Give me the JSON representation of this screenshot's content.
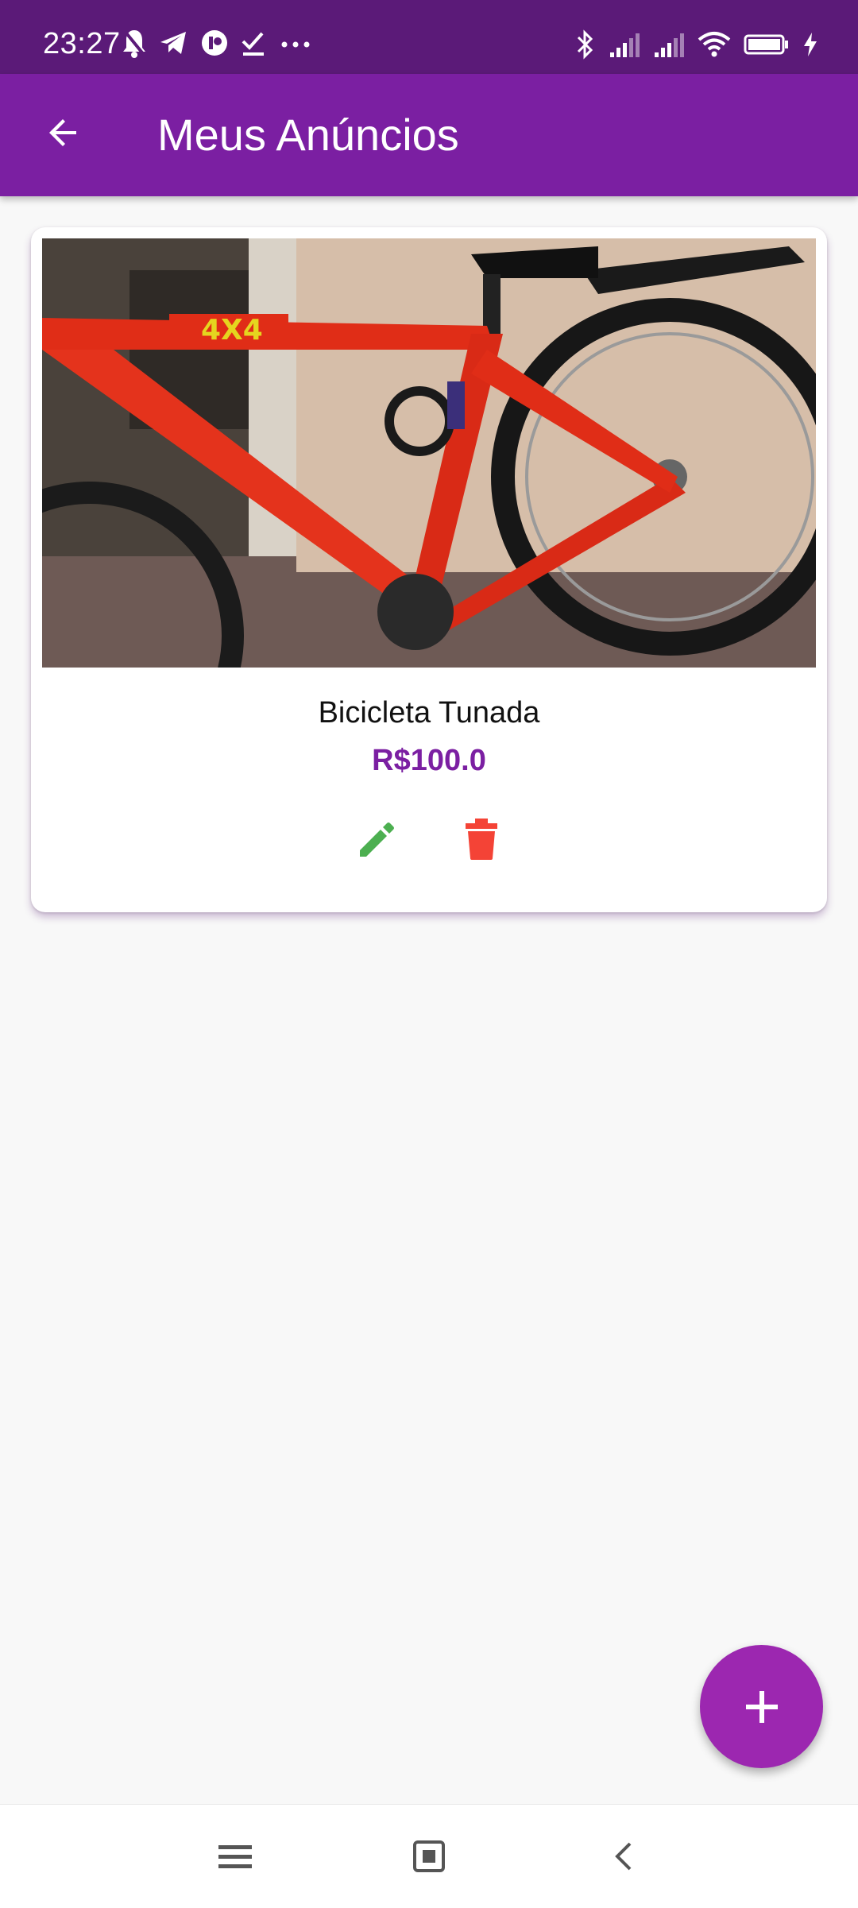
{
  "status_bar": {
    "time": "23:27",
    "icons_left": [
      "silent-bell-icon",
      "telegram-icon",
      "app-icon",
      "task-check-icon",
      "more-dots-icon"
    ],
    "icons_right": [
      "bluetooth-icon",
      "signal-icon",
      "signal-icon",
      "wifi-icon",
      "battery-icon",
      "charging-icon"
    ]
  },
  "app_bar": {
    "title": "Meus Anúncios",
    "back_icon": "arrow-back-icon"
  },
  "listing": {
    "title": "Bicicleta Tunada",
    "price": "R$100.0",
    "image_text": "4X4",
    "image_alt": "red mountain bike"
  },
  "actions": {
    "edit_icon": "pencil-icon",
    "delete_icon": "trash-icon"
  },
  "fab": {
    "icon": "plus-icon"
  },
  "nav": {
    "items": [
      "menu-icon",
      "home-square-icon",
      "back-chevron-icon"
    ]
  },
  "colors": {
    "status_bar": "#5b1a78",
    "app_bar": "#7b1fa2",
    "price": "#7b1fa2",
    "fab": "#9c27b0",
    "edit": "#4caf50",
    "delete": "#f44336"
  }
}
